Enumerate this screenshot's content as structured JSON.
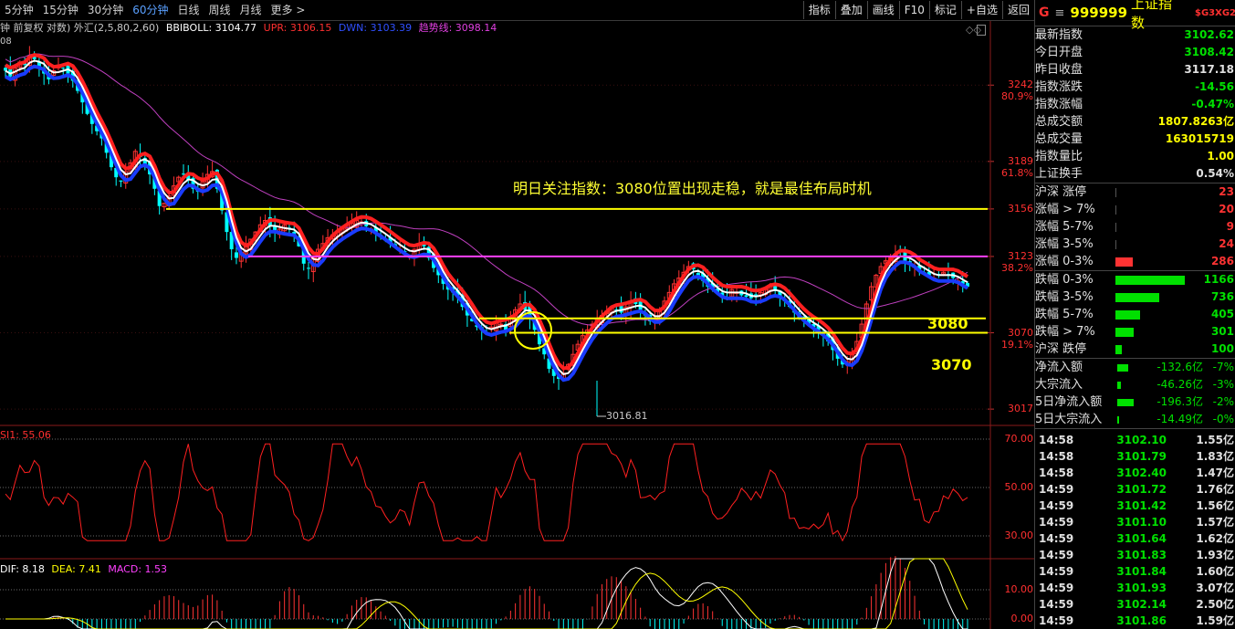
{
  "periods": [
    {
      "label": "5分钟",
      "active": false
    },
    {
      "label": "15分钟",
      "active": false
    },
    {
      "label": "30分钟",
      "active": false
    },
    {
      "label": "60分钟",
      "active": true
    },
    {
      "label": "日线",
      "active": false
    },
    {
      "label": "周线",
      "active": false
    },
    {
      "label": "月线",
      "active": false
    },
    {
      "label": "更多 >",
      "active": false
    }
  ],
  "tools": [
    "指标",
    "叠加",
    "画线",
    "F10",
    "标记",
    "+自选",
    "返回"
  ],
  "legend": {
    "prefix": "钟 前复权 对数) 外汇(2,5,80,2,60)",
    "bbiboll": "BBIBOLL: 3104.77",
    "upr": "UPR: 3106.15",
    "dwn": "DWN: 3103.39",
    "trend": "趋势线: 3098.14",
    "corner": "08"
  },
  "colors": {
    "up": "#ff3333",
    "down": "#00ffff",
    "bbi": "#ffffff",
    "upr": "#ff2020",
    "dwn": "#1a3cff",
    "trend": "#c040c0",
    "yellow": "#ffff00",
    "magenta_line": "#ff40ff",
    "green": "#00e000",
    "red": "#ff3333"
  },
  "price_axis": [
    {
      "price": "3242",
      "pct": "80.9%"
    },
    {
      "price": "3189",
      "pct": "61.8%"
    },
    {
      "price": "3156",
      "pct": ""
    },
    {
      "price": "3123",
      "pct": "38.2%"
    },
    {
      "price": "3070",
      "pct": "19.1%"
    },
    {
      "price": "3017",
      "pct": ""
    }
  ],
  "annotations": {
    "note": "明日关注指数：3080位置出现走稳，就是最佳布局时机",
    "level_3080": "3080",
    "level_3070": "3070",
    "low_label": "3016.81"
  },
  "rsi": {
    "legend": "SI1: 55.06",
    "axis": [
      "70.00",
      "50.00",
      "30.00"
    ]
  },
  "macd": {
    "dif": "DIF: 8.18",
    "dea": "DEA: 7.41",
    "macd": "MACD: 1.53",
    "axis": [
      "10.00",
      "0.00"
    ]
  },
  "side": {
    "code": "999999",
    "name": "上证指数",
    "badge": "$G3XG2",
    "g_icon": "G",
    "menu_icon": "≡",
    "quote": [
      {
        "label": "最新指数",
        "value": "3102.62",
        "color": "#00e000"
      },
      {
        "label": "今日开盘",
        "value": "3108.42",
        "color": "#00e000"
      },
      {
        "label": "昨日收盘",
        "value": "3117.18",
        "color": "#e0e0e0"
      },
      {
        "label": "指数涨跌",
        "value": "-14.56",
        "color": "#00e000"
      },
      {
        "label": "指数涨幅",
        "value": "-0.47%",
        "color": "#00e000"
      },
      {
        "label": "总成交额",
        "value": "1807.8263亿",
        "color": "#ffff00"
      },
      {
        "label": "总成交量",
        "value": "163015719",
        "color": "#ffff00"
      },
      {
        "label": "指数量比",
        "value": "1.00",
        "color": "#ffff00"
      },
      {
        "label": "上证换手",
        "value": "0.54%",
        "color": "#e0e0e0"
      }
    ],
    "rise": [
      {
        "label": "沪深 涨停",
        "value": "23",
        "bar": 0.0
      },
      {
        "label": "涨幅 > 7%",
        "value": "20",
        "bar": 0.0
      },
      {
        "label": "涨幅 5-7%",
        "value": "9",
        "bar": 0.0
      },
      {
        "label": "涨幅 3-5%",
        "value": "24",
        "bar": 0.0
      },
      {
        "label": "涨幅 0-3%",
        "value": "286",
        "bar": 0.25
      }
    ],
    "fall": [
      {
        "label": "跌幅 0-3%",
        "value": "1166",
        "bar": 1.0
      },
      {
        "label": "跌幅 3-5%",
        "value": "736",
        "bar": 0.63
      },
      {
        "label": "跌幅 5-7%",
        "value": "405",
        "bar": 0.35
      },
      {
        "label": "跌幅 > 7%",
        "value": "301",
        "bar": 0.26
      },
      {
        "label": "沪深 跌停",
        "value": "100",
        "bar": 0.09
      }
    ],
    "flows": [
      {
        "label": "净流入额",
        "amount": "-132.6亿",
        "pct": "-7%",
        "bar": 0.5
      },
      {
        "label": "大宗流入",
        "amount": "-46.26亿",
        "pct": "-3%",
        "bar": 0.18
      },
      {
        "label": "5日净流入额",
        "amount": "-196.3亿",
        "pct": "-2%",
        "bar": 0.75
      },
      {
        "label": "5日大宗流入",
        "amount": "-14.49亿",
        "pct": "-0%",
        "bar": 0.05
      }
    ],
    "ticks": [
      {
        "time": "14:58",
        "price": "3102.10",
        "amount": "1.55亿"
      },
      {
        "time": "14:58",
        "price": "3101.79",
        "amount": "1.83亿"
      },
      {
        "time": "14:58",
        "price": "3102.40",
        "amount": "1.47亿"
      },
      {
        "time": "14:59",
        "price": "3101.72",
        "amount": "1.76亿"
      },
      {
        "time": "14:59",
        "price": "3101.42",
        "amount": "1.56亿"
      },
      {
        "time": "14:59",
        "price": "3101.10",
        "amount": "1.57亿"
      },
      {
        "time": "14:59",
        "price": "3101.64",
        "amount": "1.62亿"
      },
      {
        "time": "14:59",
        "price": "3101.83",
        "amount": "1.93亿"
      },
      {
        "time": "14:59",
        "price": "3101.84",
        "amount": "1.60亿"
      },
      {
        "time": "14:59",
        "price": "3101.93",
        "amount": "3.07亿"
      },
      {
        "time": "14:59",
        "price": "3102.14",
        "amount": "2.50亿"
      },
      {
        "time": "14:59",
        "price": "3101.86",
        "amount": "1.59亿"
      }
    ]
  },
  "chart_data": {
    "type": "candlestick",
    "price_levels": {
      "upper_line": 3156,
      "magenta_line": 3123,
      "line_3080": 3080,
      "line_3070": 3070
    },
    "closes": [
      3252,
      3248,
      3254,
      3258,
      3256,
      3262,
      3260,
      3255,
      3250,
      3246,
      3252,
      3256,
      3254,
      3250,
      3245,
      3238,
      3230,
      3222,
      3215,
      3210,
      3205,
      3195,
      3185,
      3178,
      3175,
      3182,
      3188,
      3196,
      3192,
      3186,
      3180,
      3170,
      3158,
      3160,
      3165,
      3172,
      3178,
      3180,
      3176,
      3170,
      3168,
      3175,
      3180,
      3182,
      3170,
      3155,
      3140,
      3128,
      3122,
      3126,
      3130,
      3135,
      3140,
      3145,
      3148,
      3144,
      3140,
      3142,
      3145,
      3142,
      3138,
      3130,
      3118,
      3115,
      3122,
      3128,
      3132,
      3136,
      3138,
      3140,
      3142,
      3145,
      3146,
      3148,
      3147,
      3144,
      3142,
      3140,
      3138,
      3135,
      3132,
      3130,
      3128,
      3126,
      3124,
      3128,
      3132,
      3130,
      3122,
      3115,
      3110,
      3104,
      3100,
      3098,
      3095,
      3088,
      3082,
      3078,
      3074,
      3072,
      3070,
      3074,
      3078,
      3076,
      3072,
      3080,
      3086,
      3090,
      3086,
      3080,
      3072,
      3062,
      3055,
      3045,
      3040,
      3038,
      3042,
      3048,
      3055,
      3062,
      3068,
      3072,
      3076,
      3080,
      3082,
      3085,
      3088,
      3086,
      3084,
      3088,
      3092,
      3090,
      3086,
      3082,
      3078,
      3080,
      3086,
      3092,
      3098,
      3104,
      3108,
      3112,
      3116,
      3114,
      3110,
      3106,
      3102,
      3100,
      3098,
      3096,
      3098,
      3100,
      3098,
      3096,
      3095,
      3094,
      3096,
      3098,
      3100,
      3102,
      3099,
      3095,
      3092,
      3088,
      3084,
      3080,
      3078,
      3076,
      3074,
      3072,
      3068,
      3064,
      3058,
      3052,
      3048,
      3050,
      3056,
      3064,
      3076,
      3090,
      3102,
      3110,
      3116,
      3120,
      3122,
      3124,
      3126,
      3120,
      3118,
      3116,
      3114,
      3112,
      3110,
      3108,
      3110,
      3112,
      3110,
      3108,
      3106,
      3104,
      3102
    ],
    "low_point": 3016.81
  }
}
